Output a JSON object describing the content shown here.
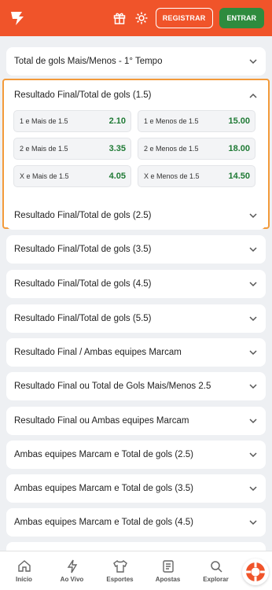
{
  "header": {
    "register_label": "REGISTRAR",
    "login_label": "ENTRAR",
    "brand_color": "#f0542a"
  },
  "markets": {
    "first": "Total de gols Mais/Menos - 1° Tempo",
    "expanded": {
      "title": "Resultado Final/Total de gols (1.5)",
      "odds": [
        {
          "label": "1 e Mais de 1.5",
          "value": "2.10"
        },
        {
          "label": "1 e Menos de 1.5",
          "value": "15.00"
        },
        {
          "label": "2 e Mais de 1.5",
          "value": "3.35"
        },
        {
          "label": "2 e Menos de 1.5",
          "value": "18.00"
        },
        {
          "label": "X e Mais de 1.5",
          "value": "4.05"
        },
        {
          "label": "X e Menos de 1.5",
          "value": "14.50"
        }
      ]
    },
    "list": [
      "Resultado Final/Total de gols (2.5)",
      "Resultado Final/Total de gols (3.5)",
      "Resultado Final/Total de gols (4.5)",
      "Resultado Final/Total de gols (5.5)",
      "Resultado Final / Ambas equipes Marcam",
      "Resultado Final ou Total de Gols Mais/Menos 2.5",
      "Resultado Final ou Ambas equipes Marcam",
      "Ambas equipes Marcam e Total de gols (2.5)",
      "Ambas equipes Marcam e Total de gols (3.5)",
      "Ambas equipes Marcam e Total de gols (4.5)"
    ]
  },
  "nav": {
    "items": [
      "Início",
      "Ao Vivo",
      "Esportes",
      "Apostas",
      "Explorar"
    ]
  },
  "colors": {
    "odds_green": "#1f7a35",
    "highlight_border": "#f39a3a"
  }
}
